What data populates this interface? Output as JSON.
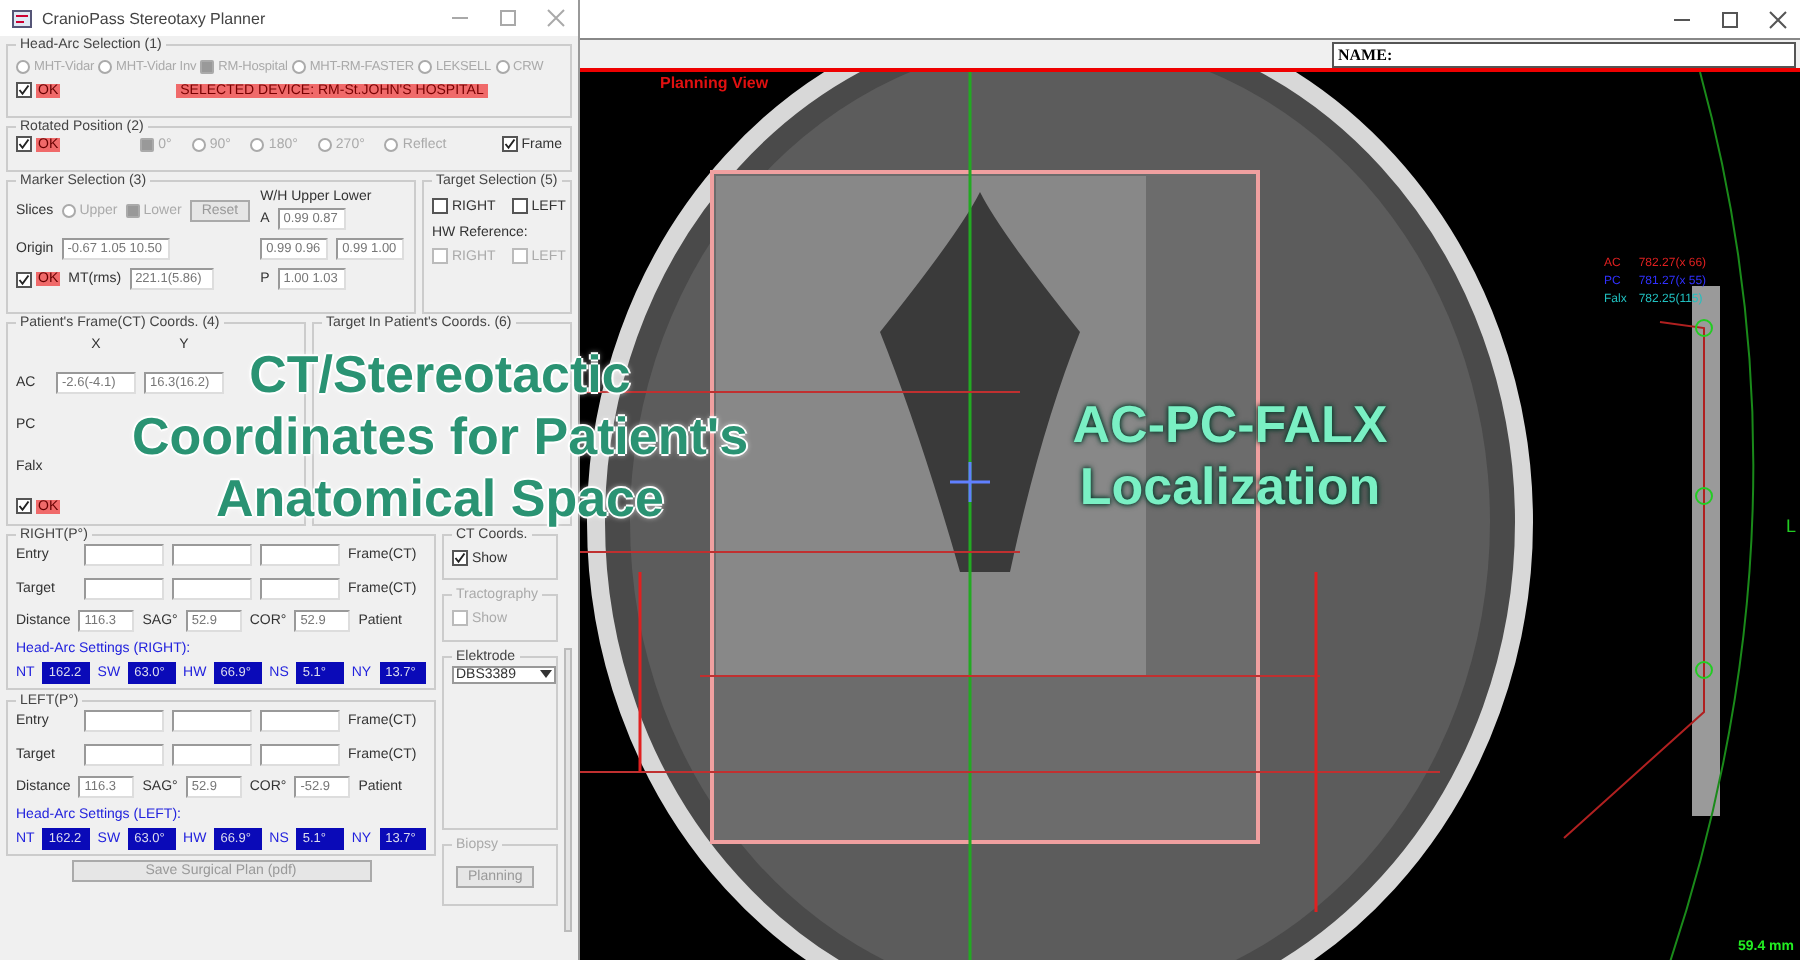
{
  "window": {
    "title": "CranioPass Stereotaxy Planner"
  },
  "head_arc_selection": {
    "title": "Head-Arc Selection (1)",
    "options": [
      {
        "label": "MHT-Vidar",
        "selected": false
      },
      {
        "label": "MHT-Vidar Inv",
        "selected": false
      },
      {
        "label": "RM-Hospital",
        "selected": true
      },
      {
        "label": "MHT-RM-FASTER",
        "selected": false
      },
      {
        "label": "LEKSELL",
        "selected": false
      },
      {
        "label": "CRW",
        "selected": false
      }
    ],
    "ok": {
      "label": "OK",
      "checked": true
    },
    "selected_device": "SELECTED DEVICE: RM-St.JOHN'S HOSPITAL"
  },
  "rotated_position": {
    "title": "Rotated Position (2)",
    "ok": {
      "label": "OK",
      "checked": true
    },
    "options": [
      {
        "label": "0°",
        "selected": true
      },
      {
        "label": "90°",
        "selected": false
      },
      {
        "label": "180°",
        "selected": false
      },
      {
        "label": "270°",
        "selected": false
      },
      {
        "label": "Reflect",
        "selected": false
      }
    ],
    "frame": {
      "label": "Frame",
      "checked": true
    }
  },
  "marker_selection": {
    "title": "Marker Selection (3)",
    "slices_label": "Slices",
    "slices": [
      {
        "label": "Upper",
        "selected": false
      },
      {
        "label": "Lower",
        "selected": true
      }
    ],
    "reset_button": "Reset",
    "wh_header": "W/H Upper Lower",
    "a_label": "A",
    "a_value": "0.99  0.87",
    "origin_label": "Origin",
    "origin_value": "-0.67  1.05  10.50",
    "upper_value": "0.99  0.96",
    "lower_value": "0.99  1.00",
    "ok": {
      "label": "OK",
      "checked": true
    },
    "mt_label": "MT(rms)",
    "mt_value": "221.1(5.86)",
    "p_label": "P",
    "p_value": "1.00  1.03"
  },
  "target_selection": {
    "title": "Target Selection (5)",
    "targets": [
      {
        "label": "RIGHT",
        "checked": false,
        "disabled": false
      },
      {
        "label": "LEFT",
        "checked": false,
        "disabled": false
      }
    ],
    "hw_reference_label": "HW Reference:",
    "hw_reference": [
      {
        "label": "RIGHT",
        "checked": false,
        "disabled": true
      },
      {
        "label": "LEFT",
        "checked": false,
        "disabled": true
      }
    ]
  },
  "patient_frame": {
    "title": "Patient's Frame(CT) Coords. (4)",
    "columns": [
      "X",
      "Y"
    ],
    "rows": [
      {
        "label": "AC",
        "values": [
          "-2.6(-4.1)",
          "16.3(16.2)"
        ]
      },
      {
        "label": "PC",
        "values": []
      },
      {
        "label": "Falx",
        "values": []
      }
    ],
    "ok": {
      "label": "OK",
      "checked": true
    }
  },
  "target_patient": {
    "title": "Target In Patient's Coords. (6)"
  },
  "sides": [
    {
      "title": "RIGHT(P°)",
      "rows": [
        {
          "label": "Entry",
          "suffix": "Frame(CT)"
        },
        {
          "label": "Target",
          "suffix": "Frame(CT)"
        }
      ],
      "distance_label": "Distance",
      "distance": "116.3",
      "sag_label": "SAG°",
      "sag": "52.9",
      "cor_label": "COR°",
      "cor": "52.9",
      "patient_label": "Patient",
      "settings_title": "Head-Arc Settings (RIGHT):",
      "settings": [
        {
          "label": "NT",
          "value": "162.2"
        },
        {
          "label": "SW",
          "value": "63.0°"
        },
        {
          "label": "HW",
          "value": "66.9°"
        },
        {
          "label": "NS",
          "value": "5.1°"
        },
        {
          "label": "NY",
          "value": "13.7°"
        }
      ]
    },
    {
      "title": "LEFT(P°)",
      "rows": [
        {
          "label": "Entry",
          "suffix": "Frame(CT)"
        },
        {
          "label": "Target",
          "suffix": "Frame(CT)"
        }
      ],
      "distance_label": "Distance",
      "distance": "116.3",
      "sag_label": "SAG°",
      "sag": "52.9",
      "cor_label": "COR°",
      "cor": "-52.9",
      "patient_label": "Patient",
      "settings_title": "Head-Arc Settings (LEFT):",
      "settings": [
        {
          "label": "NT",
          "value": "162.2"
        },
        {
          "label": "SW",
          "value": "63.0°"
        },
        {
          "label": "HW",
          "value": "66.9°"
        },
        {
          "label": "NS",
          "value": "5.1°"
        },
        {
          "label": "NY",
          "value": "13.7°"
        }
      ]
    }
  ],
  "save_button": {
    "label": "Save Surgical Plan (pdf)",
    "disabled": true
  },
  "ct_coords": {
    "title": "CT Coords.",
    "show": {
      "label": "Show",
      "checked": true,
      "disabled": false
    }
  },
  "tractography": {
    "title": "Tractography",
    "show": {
      "label": "Show",
      "checked": false,
      "disabled": true
    }
  },
  "electrode": {
    "title": "Elektrode",
    "value": "DBS3389"
  },
  "biopsy": {
    "title": "Biopsy",
    "button": {
      "label": "Planning",
      "disabled": true
    }
  },
  "viewer": {
    "name_label": "NAME:",
    "view_title": "Planning View",
    "markers": [
      {
        "label": "AC",
        "value": "782.27(x 66)",
        "color": "#e02020"
      },
      {
        "label": "PC",
        "value": "781.27(x 55)",
        "color": "#3030ff"
      },
      {
        "label": "Falx",
        "value": "782.25(115)",
        "color": "#20c0c0"
      }
    ],
    "side_letter": "L",
    "scale": "59.4 mm"
  },
  "annotations": [
    {
      "lines": [
        "CT/Stereotactic",
        "Coordinates for Patient's",
        "Anatomical Space"
      ]
    },
    {
      "lines": [
        "AC-PC-FALX",
        "Localization"
      ]
    }
  ]
}
